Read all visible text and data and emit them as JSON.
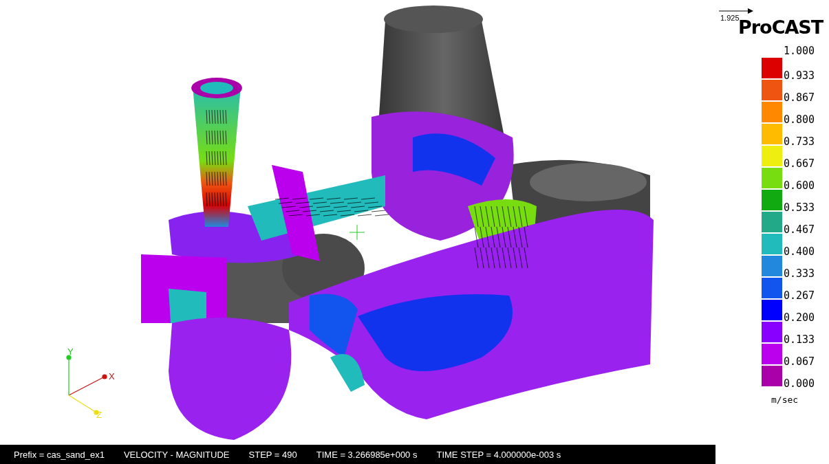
{
  "viewport": {
    "axes": [
      {
        "kind": "x",
        "label": "X"
      },
      {
        "kind": "y",
        "label": "Y"
      },
      {
        "kind": "z",
        "label": "Z"
      }
    ]
  },
  "vector_scale": {
    "value": "1.925"
  },
  "brand": {
    "logo": "ProCAST"
  },
  "legend": {
    "top_label": "1.000",
    "unit": "m/sec",
    "bins": [
      {
        "color": "#dd0000",
        "label": "0.933"
      },
      {
        "color": "#ee5511",
        "label": "0.867"
      },
      {
        "color": "#ff8800",
        "label": "0.800"
      },
      {
        "color": "#ffbb00",
        "label": "0.733"
      },
      {
        "color": "#eeee11",
        "label": "0.667"
      },
      {
        "color": "#77dd11",
        "label": "0.600"
      },
      {
        "color": "#11aa11",
        "label": "0.533"
      },
      {
        "color": "#22aa88",
        "label": "0.467"
      },
      {
        "color": "#22bbbb",
        "label": "0.400"
      },
      {
        "color": "#2288dd",
        "label": "0.333"
      },
      {
        "color": "#1155ee",
        "label": "0.267"
      },
      {
        "color": "#0000ff",
        "label": "0.200"
      },
      {
        "color": "#8800ff",
        "label": "0.133"
      },
      {
        "color": "#bb00ee",
        "label": "0.067"
      },
      {
        "color": "#aa00aa",
        "label": "0.000"
      }
    ]
  },
  "status_bar": [
    "Prefix = cas_sand_ex1",
    "VELOCITY - MAGNITUDE",
    "STEP = 490",
    "TIME = 3.266985e+000 s",
    "TIME STEP = 4.000000e-003 s"
  ]
}
